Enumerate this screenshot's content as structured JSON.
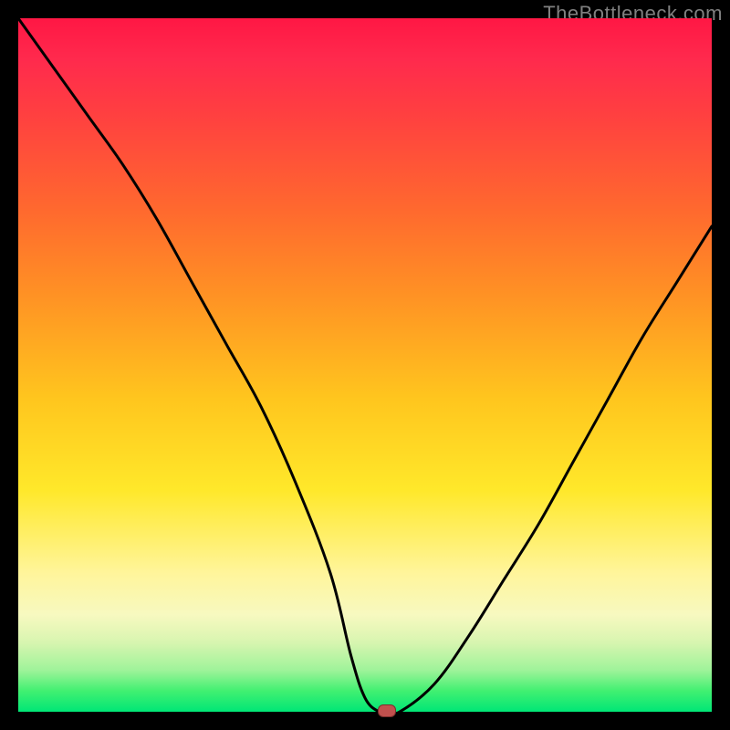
{
  "watermark": {
    "text": "TheBottleneck.com"
  },
  "chart_data": {
    "type": "line",
    "title": "",
    "xlabel": "",
    "ylabel": "",
    "xlim": [
      0,
      100
    ],
    "ylim": [
      0,
      100
    ],
    "grid": false,
    "legend": false,
    "background_gradient": {
      "stops": [
        "#ff1744",
        "#ff6a2e",
        "#ffe82a",
        "#f7f9c0",
        "#00e676"
      ],
      "orientation": "vertical",
      "meaning": "bottleneck severity (top=high, bottom=low)"
    },
    "series": [
      {
        "name": "bottleneck-curve",
        "x": [
          0,
          5,
          10,
          15,
          20,
          25,
          30,
          35,
          40,
          45,
          48,
          50,
          52,
          53,
          55,
          60,
          65,
          70,
          75,
          80,
          85,
          90,
          95,
          100
        ],
        "y": [
          100,
          93,
          86,
          79,
          71,
          62,
          53,
          44,
          33,
          20,
          8,
          2,
          0,
          0,
          0,
          4,
          11,
          19,
          27,
          36,
          45,
          54,
          62,
          70
        ]
      }
    ],
    "marker": {
      "x": 53,
      "y": 0,
      "color": "#c0504d"
    }
  }
}
